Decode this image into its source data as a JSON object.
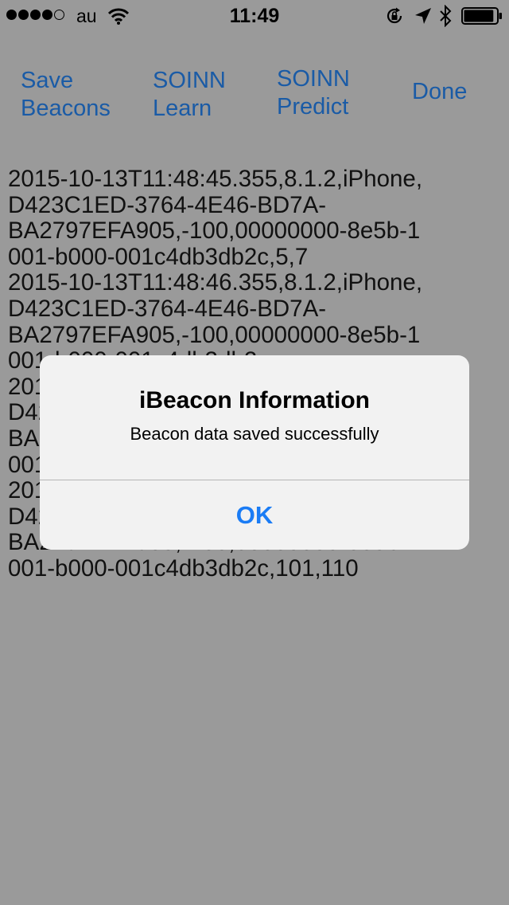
{
  "status_bar": {
    "carrier": "au",
    "time": "11:49",
    "signal_bars_filled": 4,
    "signal_bars_total": 5,
    "battery_level": 0.92
  },
  "toolbar": {
    "save_label": "Save\nBeacons",
    "learn_label": "SOINN\nLearn",
    "predict_label": "SOINN\nPredict",
    "done_label": "Done",
    "tint_color": "#1a5ba6"
  },
  "log": {
    "text": "2015-10-13T11:48:45.355,8.1.2,iPhone,\nD423C1ED-3764-4E46-BD7A-\nBA2797EFA905,-100,00000000-8e5b-1\n001-b000-001c4db3db2c,5,7\n2015-10-13T11:48:46.355,8.1.2,iPhone,\nD423C1ED-3764-4E46-BD7A-\nBA2797EFA905,-100,00000000-8e5b-1\n001-b000-001c4db3db2c,\n2015-10-13T11:48:46.355,8.1.2,iPhone,\nD423C1ED-3764-4E46-BD7A-\nBA2797EFA905,-100,00000000-8e5b-1\n001-b000-001c4db3db2c,\n2015-10-13T11:48:46.355,8.1.2,iPhone,\nD423C1ED-3764-4E46-BD7A-\nBA2797EFA905,-100,00000000-8e5b-1\n001-b000-001c4db3db2c,101,110"
  },
  "alert": {
    "title": "iBeacon Information",
    "message": "Beacon data saved successfully",
    "ok_label": "OK",
    "button_color": "#1a7cf5"
  }
}
